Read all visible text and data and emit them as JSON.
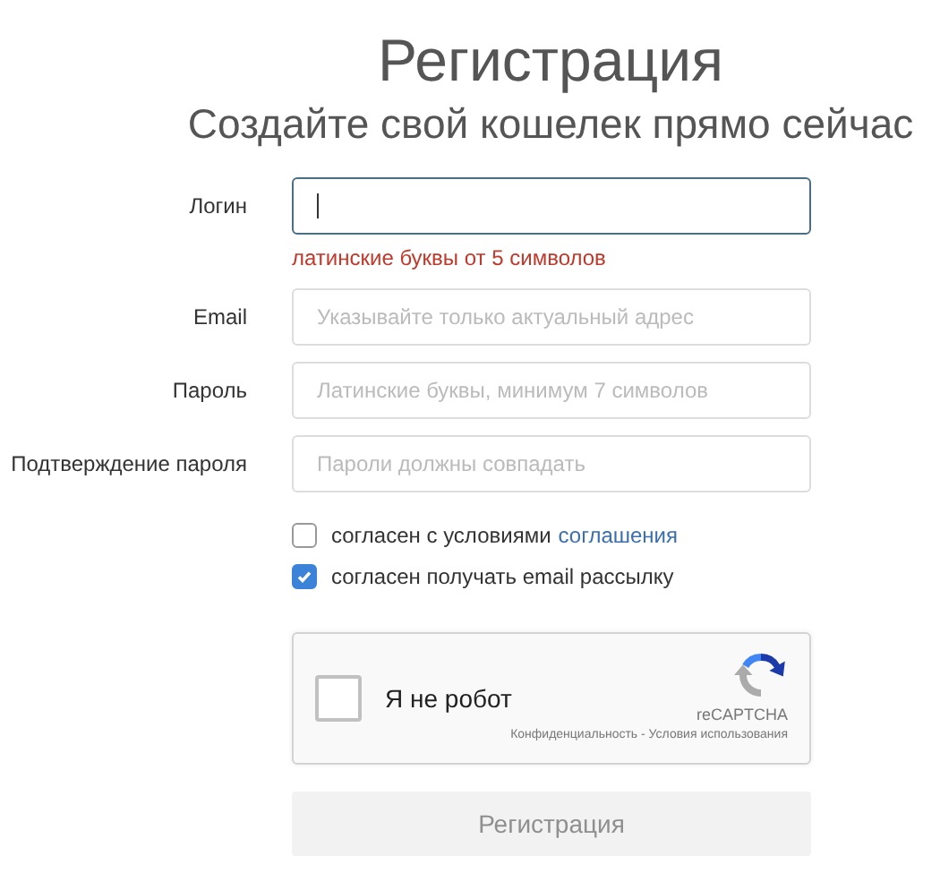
{
  "title": "Регистрация",
  "subtitle": "Создайте свой кошелек прямо сейчас",
  "fields": [
    {
      "label": "Логин",
      "focused": true,
      "hint": "латинские буквы от 5 символов"
    },
    {
      "label": "Email",
      "placeholder": "Указывайте только актуальный адрес",
      "focused": false
    },
    {
      "label": "Пароль",
      "placeholder": "Латинские буквы, минимум 7 символов",
      "focused": false
    },
    {
      "label": "Подтверждение пароля",
      "placeholder": "Пароли должны совпадать",
      "focused": false
    }
  ],
  "checkboxes": [
    {
      "text": "согласен с условиями",
      "link": "соглашения",
      "checked": false
    },
    {
      "text": "согласен получать email рассылку",
      "checked": true
    }
  ],
  "captcha": {
    "label": "Я не робот",
    "checked": false,
    "brand": "reCAPTCHA",
    "terms": "Конфиденциальность - Условия использования"
  },
  "submit": {
    "label": "Регистрация",
    "disabled": true
  }
}
